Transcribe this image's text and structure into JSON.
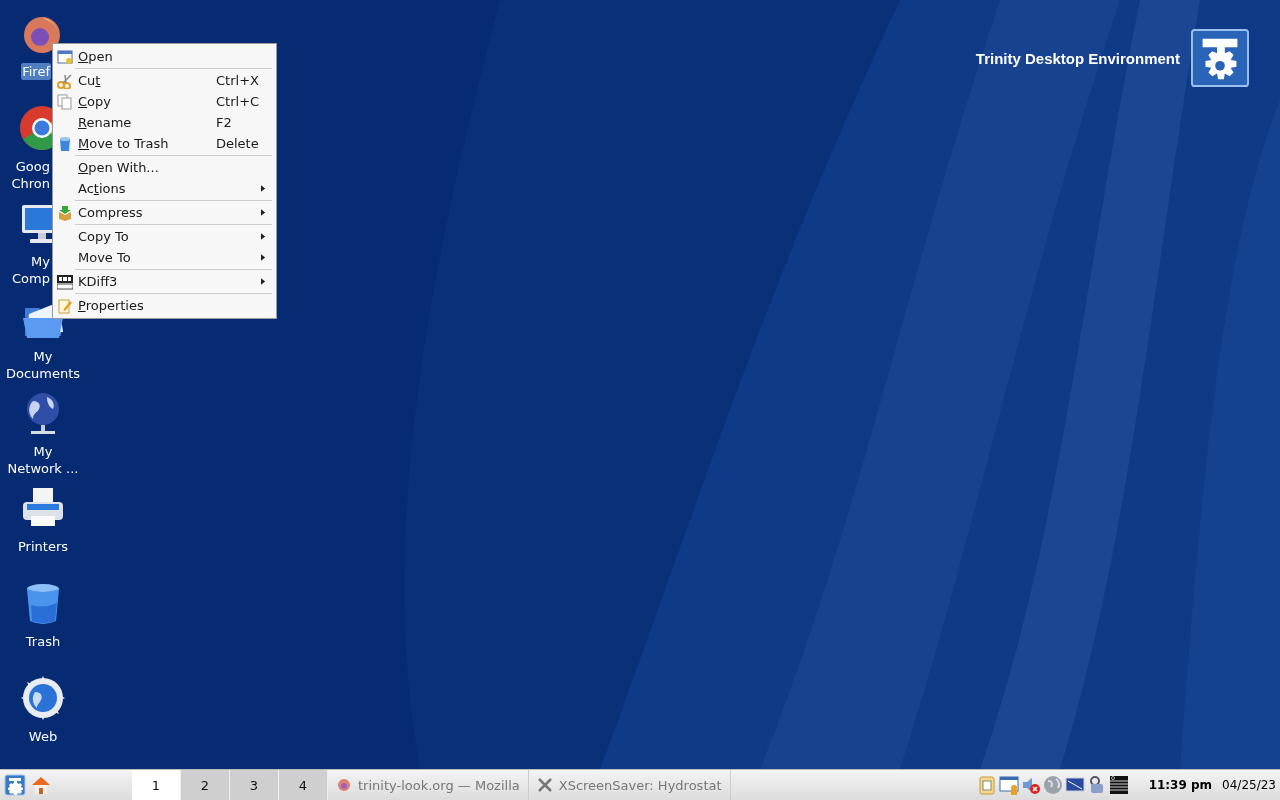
{
  "desktop": {
    "caption": "Trinity Desktop Environment",
    "icons": [
      {
        "kind": "firefox",
        "label": [
          "Firef"
        ],
        "selected": true,
        "covered": true
      },
      {
        "kind": "chrome",
        "label": [
          "Goog",
          "Chron"
        ],
        "selected": false,
        "covered": true
      },
      {
        "kind": "computer",
        "label": [
          "My",
          "Comp"
        ],
        "selected": false,
        "covered": true
      },
      {
        "kind": "documents",
        "label": [
          "My",
          "Documents"
        ],
        "selected": false,
        "covered": false
      },
      {
        "kind": "network",
        "label": [
          "My",
          "Network ..."
        ],
        "selected": false,
        "covered": false
      },
      {
        "kind": "printer",
        "label": [
          "Printers"
        ],
        "selected": false,
        "covered": false
      },
      {
        "kind": "trash",
        "label": [
          "Trash"
        ],
        "selected": false,
        "covered": false
      },
      {
        "kind": "web",
        "label": [
          "Web"
        ],
        "selected": false,
        "covered": false
      }
    ]
  },
  "context_menu": {
    "sections": [
      [
        {
          "kind": "open",
          "label": "Open",
          "submenu": false
        }
      ],
      [
        {
          "kind": "cut",
          "label": "Cut",
          "shortcut": "Ctrl+X",
          "submenu": false
        },
        {
          "kind": "copy",
          "label": "Copy",
          "shortcut": "Ctrl+C",
          "submenu": false
        },
        {
          "kind": "plain",
          "label": "Rename",
          "shortcut": "F2",
          "submenu": false
        },
        {
          "kind": "trash",
          "label": "Move to Trash",
          "shortcut": "Delete",
          "submenu": false
        }
      ],
      [
        {
          "kind": "plain",
          "label": "Open With...",
          "submenu": false
        },
        {
          "kind": "plain",
          "label": "Actions",
          "submenu": true
        }
      ],
      [
        {
          "kind": "compress",
          "label": "Compress",
          "submenu": true
        }
      ],
      [
        {
          "kind": "plain",
          "label": "Copy To",
          "submenu": true
        },
        {
          "kind": "plain",
          "label": "Move To",
          "submenu": true
        }
      ],
      [
        {
          "kind": "kdiff",
          "label": "KDiff3",
          "submenu": true
        }
      ],
      [
        {
          "kind": "properties",
          "label": "Properties",
          "submenu": false
        }
      ]
    ]
  },
  "taskbar": {
    "desktops": [
      {
        "label": "1",
        "selected": true
      },
      {
        "label": "2",
        "selected": false
      },
      {
        "label": "3",
        "selected": false
      },
      {
        "label": "4",
        "selected": false
      }
    ],
    "tasks": [
      {
        "kind": "firefox",
        "title": "trinity-look.org — Mozilla"
      },
      {
        "kind": "xscreensaver",
        "title": "XScreenSaver: Hydrostat"
      }
    ],
    "clock": {
      "time": "11:39 pm",
      "date": "04/25/23"
    }
  }
}
